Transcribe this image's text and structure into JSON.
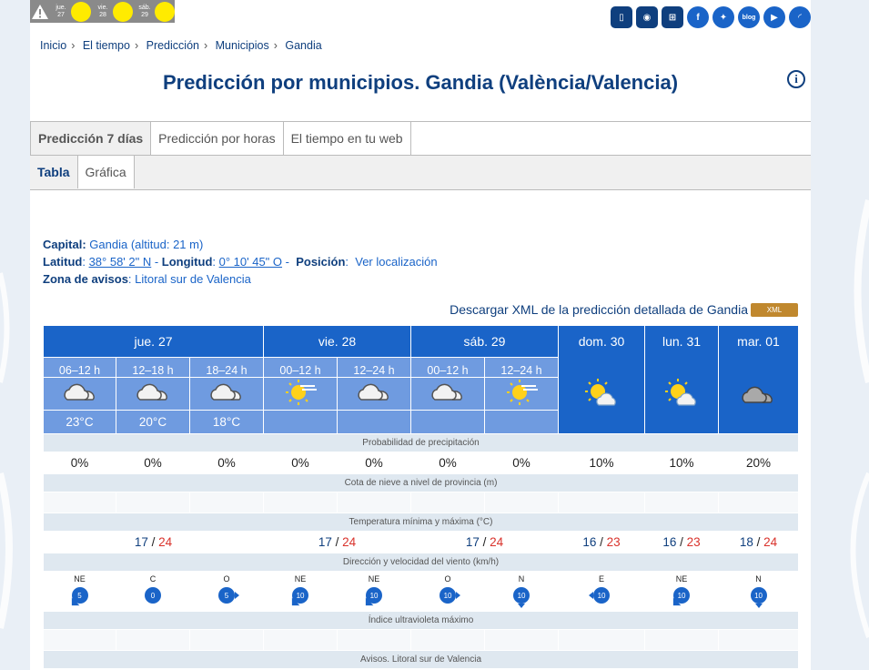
{
  "warnings": {
    "days": [
      {
        "dow": "jue.",
        "num": "27"
      },
      {
        "dow": "vie.",
        "num": "28"
      },
      {
        "dow": "sáb.",
        "num": "29"
      }
    ]
  },
  "social": [
    "mobile",
    "app",
    "sitemap",
    "f",
    "twitter",
    "blog",
    "youtube",
    "rss"
  ],
  "breadcrumb": [
    "Inicio",
    "El tiempo",
    "Predicción",
    "Municipios",
    "Gandia"
  ],
  "page_title": "Predicción por municipios. Gandia (València/Valencia)",
  "tabs": [
    "Predicción 7 días",
    "Predicción por horas",
    "El tiempo en tu web"
  ],
  "subtabs": [
    "Tabla",
    "Gráfica"
  ],
  "meta": {
    "capital_label": "Capital:",
    "capital_value": "Gandia (altitud: 21 m)",
    "lat_label": "Latitud",
    "lat_value": "38° 58' 2\" N",
    "lon_label": "Longitud",
    "lon_value": "0° 10' 45\" O",
    "pos_label": "Posición",
    "pos_value": "Ver localización",
    "zone_label": "Zona de avisos",
    "zone_value": "Litoral sur de Valencia"
  },
  "download": {
    "label": "Descargar XML de la predicción detallada de Gandia",
    "badge": "XML"
  },
  "forecast": {
    "days": [
      "jue. 27",
      "vie. 28",
      "sáb. 29",
      "dom. 30",
      "lun. 31",
      "mar. 01"
    ],
    "periods": [
      "06–12 h",
      "12–18 h",
      "18–24 h",
      "00–12 h",
      "12–24 h",
      "00–12 h",
      "12–24 h"
    ],
    "temps": [
      "23°C",
      "20°C",
      "18°C"
    ],
    "precip_label": "Probabilidad de precipitación",
    "precip": [
      "0%",
      "0%",
      "0%",
      "0%",
      "0%",
      "0%",
      "0%",
      "10%",
      "10%",
      "20%"
    ],
    "snow_label": "Cota de nieve a nivel de provincia (m)",
    "minmax_label": "Temperatura mínima y máxima (°C)",
    "minmax": [
      {
        "min": "17",
        "max": "24"
      },
      {
        "min": "17",
        "max": "24"
      },
      {
        "min": "17",
        "max": "24"
      },
      {
        "min": "16",
        "max": "23"
      },
      {
        "min": "16",
        "max": "23"
      },
      {
        "min": "18",
        "max": "24"
      }
    ],
    "wind_label": "Dirección y velocidad del viento (km/h)",
    "wind": [
      {
        "dir": "NE",
        "speed": "5"
      },
      {
        "dir": "C",
        "speed": "0"
      },
      {
        "dir": "O",
        "speed": "5"
      },
      {
        "dir": "NE",
        "speed": "10"
      },
      {
        "dir": "NE",
        "speed": "10"
      },
      {
        "dir": "O",
        "speed": "10"
      },
      {
        "dir": "N",
        "speed": "10"
      },
      {
        "dir": "E",
        "speed": "10"
      },
      {
        "dir": "NE",
        "speed": "10"
      },
      {
        "dir": "N",
        "speed": "10"
      }
    ],
    "uv_label": "Índice ultravioleta máximo",
    "warnings_label": "Avisos. Litoral sur de Valencia"
  }
}
